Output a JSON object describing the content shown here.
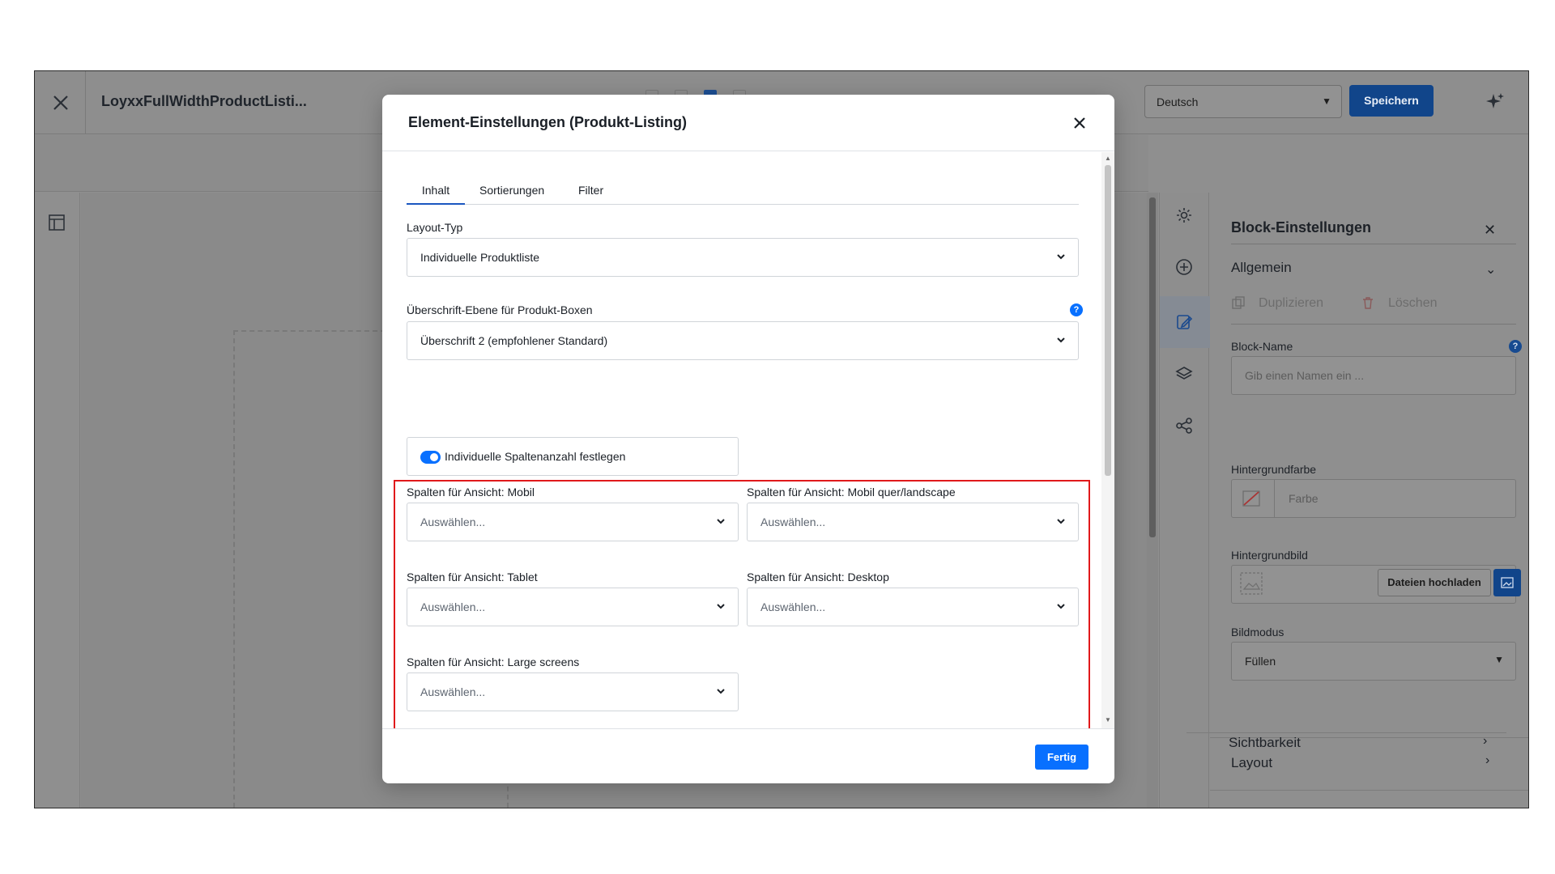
{
  "window": {
    "title": "LoyxxFullWidthProductListi...",
    "language": "Deutsch",
    "save_label": "Speichern"
  },
  "side_panel": {
    "title": "Block-Einstellungen",
    "section_general": "Allgemein",
    "duplicate_label": "Duplizieren",
    "delete_label": "Löschen",
    "block_name_label": "Block-Name",
    "block_name_placeholder": "Gib einen Namen ein ...",
    "bg_color_label": "Hintergrundfarbe",
    "bg_color_placeholder": "Farbe",
    "bg_image_label": "Hintergrundbild",
    "upload_label": "Dateien hochladen",
    "image_mode_label": "Bildmodus",
    "image_mode_value": "Füllen",
    "section_layout": "Layout",
    "section_visibility": "Sichtbarkeit"
  },
  "modal": {
    "title": "Element-Einstellungen (Produkt-Listing)",
    "tabs": [
      {
        "label": "Inhalt",
        "active": true
      },
      {
        "label": "Sortierungen",
        "active": false
      },
      {
        "label": "Filter",
        "active": false
      }
    ],
    "layout_type_label": "Layout-Typ",
    "layout_type_value": "Individuelle Produktliste",
    "heading_level_label": "Überschrift-Ebene für Produkt-Boxen",
    "heading_level_value": "Überschrift 2 (empfohlener Standard)",
    "custom_columns_toggle_label": "Individuelle Spaltenanzahl festlegen",
    "custom_columns_enabled": true,
    "columns": {
      "mobile_label": "Spalten für Ansicht: Mobil",
      "mobile_landscape_label": "Spalten für Ansicht: Mobil quer/landscape",
      "tablet_label": "Spalten für Ansicht: Tablet",
      "desktop_label": "Spalten für Ansicht: Desktop",
      "large_label": "Spalten für Ansicht: Large screens",
      "placeholder": "Auswählen..."
    },
    "done_label": "Fertig"
  },
  "colors": {
    "primary": "#0870ff",
    "highlight": "#e0191b",
    "save_button": "#11458a"
  },
  "icons": {
    "help": "?",
    "close": "x-icon",
    "chevron": "chevron-down-icon"
  }
}
